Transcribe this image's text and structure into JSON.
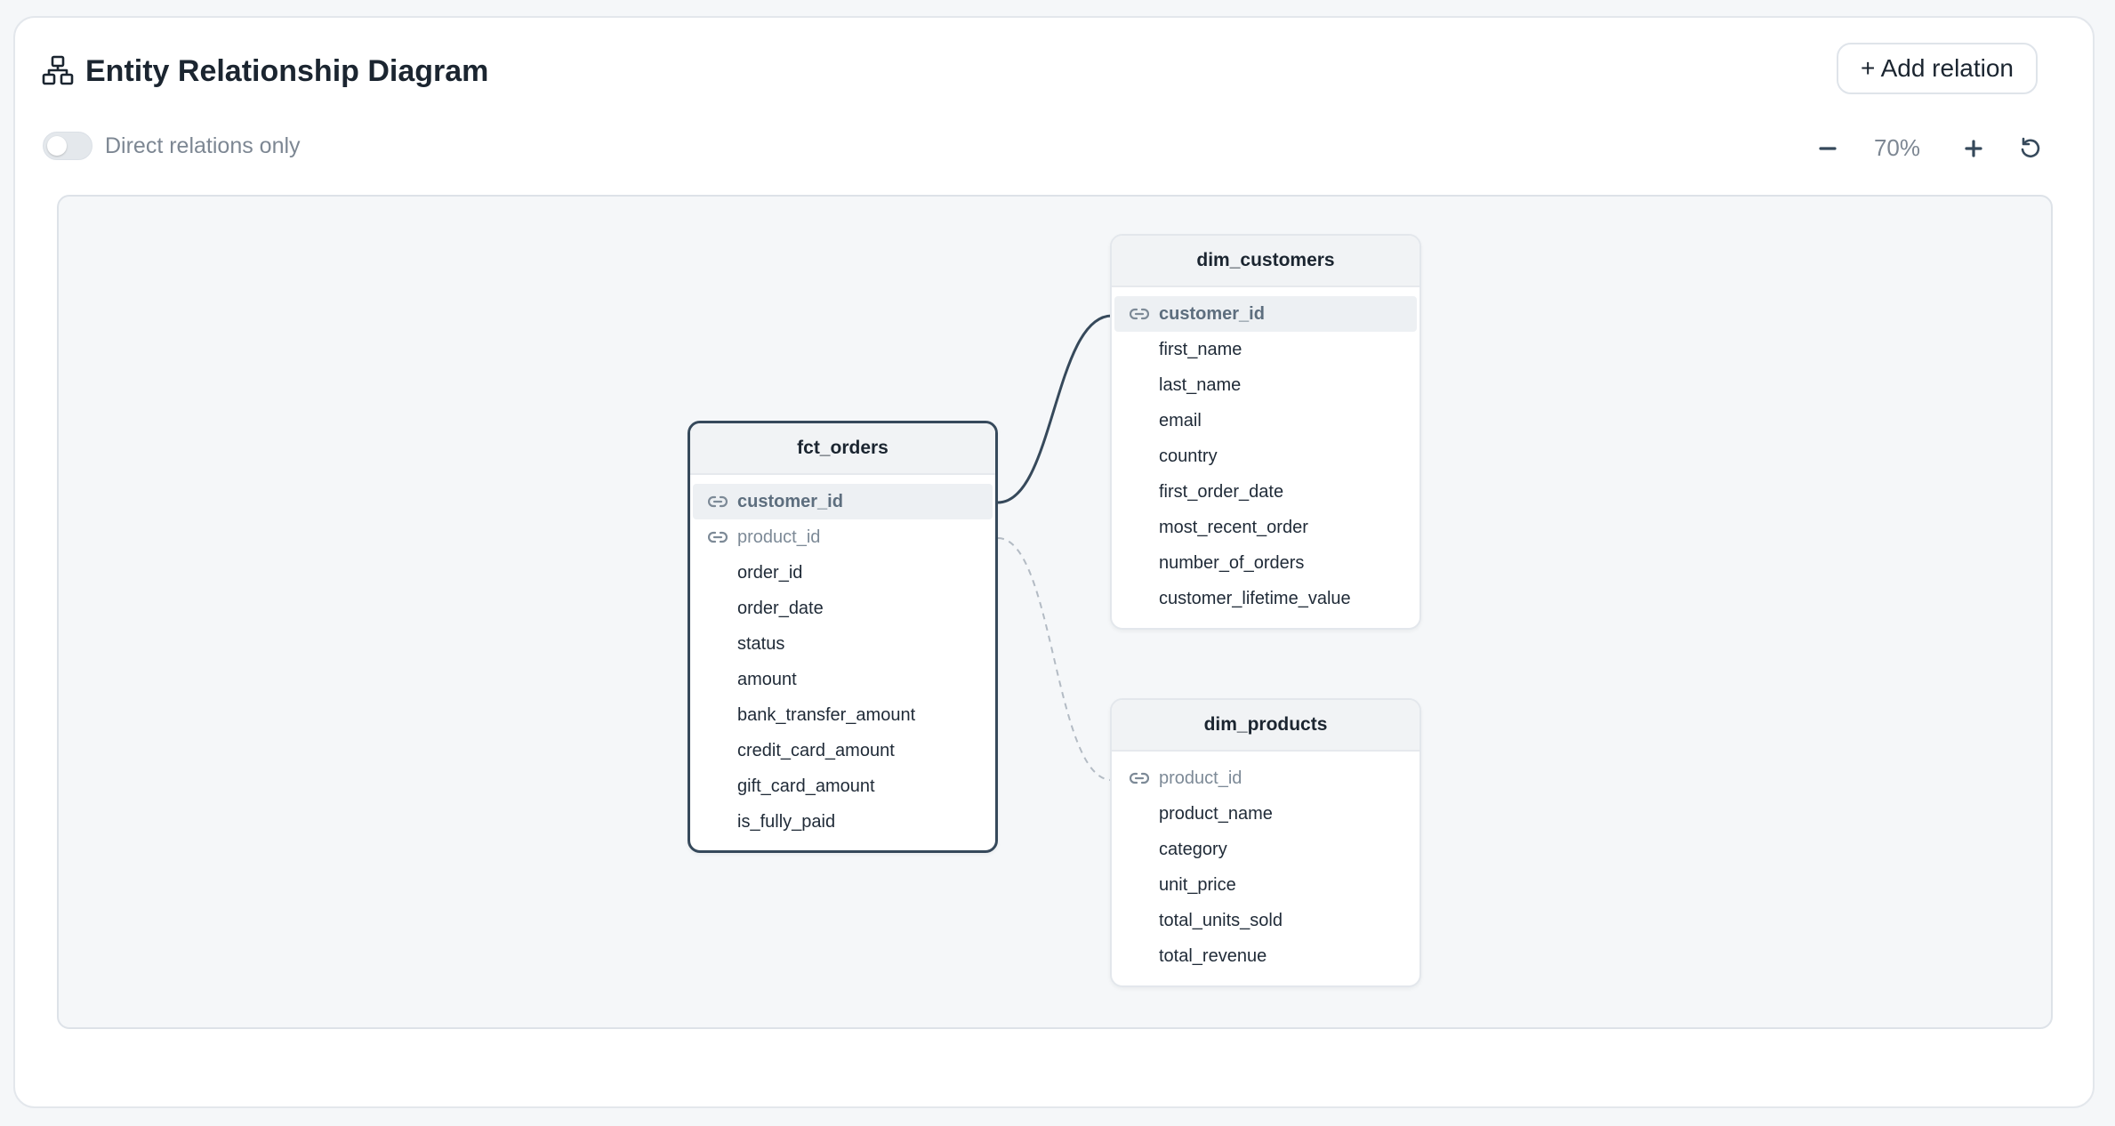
{
  "header": {
    "title": "Entity Relationship Diagram",
    "icon": "hierarchy-icon",
    "add_relation_label": "+ Add relation"
  },
  "controls": {
    "toggle_label": "Direct relations only",
    "toggle_on": false,
    "zoom_level": "70%",
    "zoom_out_icon": "minus-icon",
    "zoom_in_icon": "plus-icon",
    "reset_icon": "reset-icon"
  },
  "tables": {
    "fct_orders": {
      "name": "fct_orders",
      "focused": true,
      "columns": [
        {
          "name": "customer_id",
          "key": true,
          "highlighted": true
        },
        {
          "name": "product_id",
          "key": true,
          "highlighted": false
        },
        {
          "name": "order_id"
        },
        {
          "name": "order_date"
        },
        {
          "name": "status"
        },
        {
          "name": "amount"
        },
        {
          "name": "bank_transfer_amount"
        },
        {
          "name": "credit_card_amount"
        },
        {
          "name": "gift_card_amount"
        },
        {
          "name": "is_fully_paid"
        }
      ]
    },
    "dim_customers": {
      "name": "dim_customers",
      "columns": [
        {
          "name": "customer_id",
          "key": true,
          "highlighted": true
        },
        {
          "name": "first_name"
        },
        {
          "name": "last_name"
        },
        {
          "name": "email"
        },
        {
          "name": "country"
        },
        {
          "name": "first_order_date"
        },
        {
          "name": "most_recent_order"
        },
        {
          "name": "number_of_orders"
        },
        {
          "name": "customer_lifetime_value"
        }
      ]
    },
    "dim_products": {
      "name": "dim_products",
      "columns": [
        {
          "name": "product_id",
          "key": true,
          "highlighted": false
        },
        {
          "name": "product_name"
        },
        {
          "name": "category"
        },
        {
          "name": "unit_price"
        },
        {
          "name": "total_units_sold"
        },
        {
          "name": "total_revenue"
        }
      ]
    }
  },
  "relations": [
    {
      "from": "fct_orders.customer_id",
      "to": "dim_customers.customer_id",
      "style": "solid"
    },
    {
      "from": "fct_orders.product_id",
      "to": "dim_products.product_id",
      "style": "dashed"
    }
  ],
  "colors": {
    "active_edge": "#36495b",
    "inactive_edge": "#b3bbc4",
    "highlight_row": "#edf0f3"
  }
}
